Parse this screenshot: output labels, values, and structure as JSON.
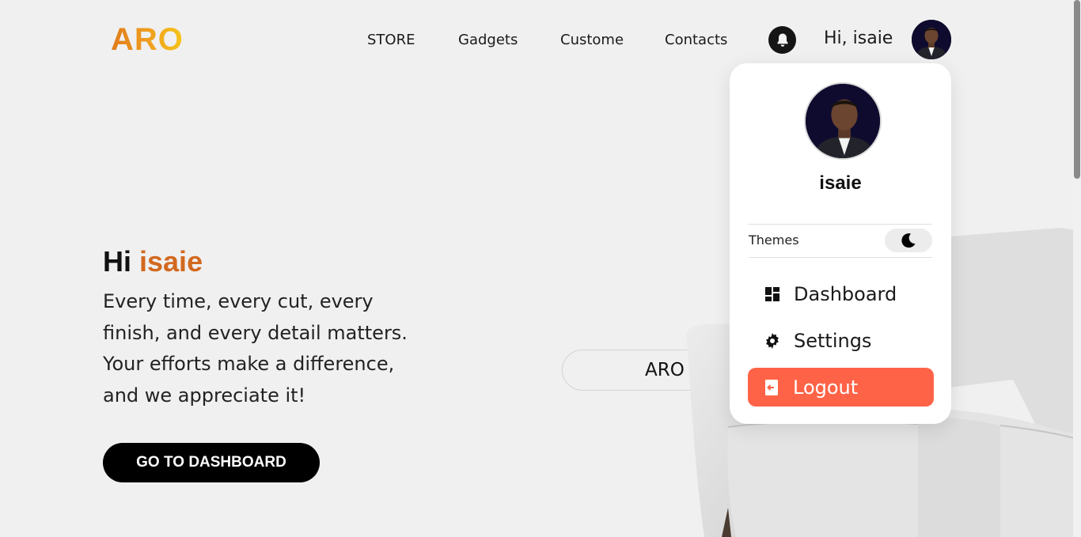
{
  "brand": {
    "logo_text": "ARO"
  },
  "nav": {
    "items": [
      {
        "label": "STORE"
      },
      {
        "label": "Gadgets"
      },
      {
        "label": "Custome"
      },
      {
        "label": "Contacts"
      }
    ]
  },
  "header": {
    "greeting": "Hi, isaie",
    "notification_icon": "bell-icon"
  },
  "hero": {
    "title_prefix": "Hi",
    "title_name": "isaie",
    "text": "Every time, every cut, every finish, and every detail matters. Your efforts make a difference, and we appreciate it!",
    "cta_label": "GO TO DASHBOARD",
    "pill_label": "ARO GROUP"
  },
  "dropdown": {
    "username": "isaie",
    "themes_label": "Themes",
    "theme_icon": "moon-icon",
    "menu": [
      {
        "label": "Dashboard",
        "icon": "dashboard-icon"
      },
      {
        "label": "Settings",
        "icon": "gear-icon"
      },
      {
        "label": "Logout",
        "icon": "logout-icon"
      }
    ]
  },
  "colors": {
    "accent": "#d2691e",
    "logout": "#ff6347",
    "logo_start": "#e07b1c",
    "logo_end": "#f5c518"
  }
}
